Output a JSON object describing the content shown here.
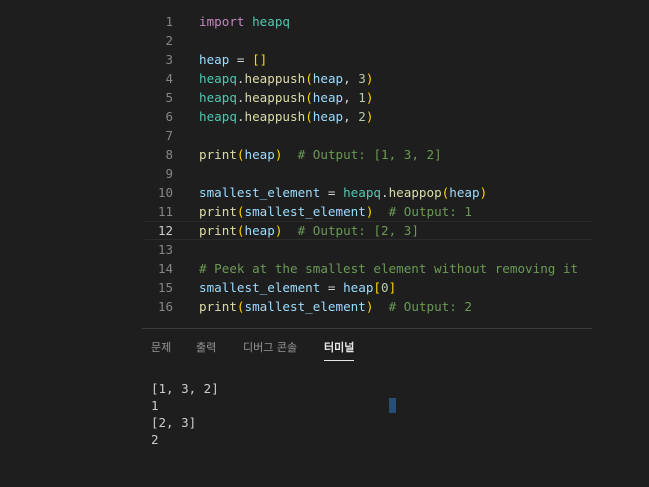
{
  "editor": {
    "lines": [
      {
        "num": "1",
        "tokens": [
          {
            "t": "import",
            "c": "kw"
          },
          {
            "t": " ",
            "c": "op"
          },
          {
            "t": "heapq",
            "c": "mod"
          }
        ]
      },
      {
        "num": "2",
        "tokens": []
      },
      {
        "num": "3",
        "tokens": [
          {
            "t": "heap",
            "c": "var"
          },
          {
            "t": " = ",
            "c": "op"
          },
          {
            "t": "[]",
            "c": "p1"
          }
        ]
      },
      {
        "num": "4",
        "tokens": [
          {
            "t": "heapq",
            "c": "mod"
          },
          {
            "t": ".",
            "c": "op"
          },
          {
            "t": "heappush",
            "c": "fn"
          },
          {
            "t": "(",
            "c": "p1"
          },
          {
            "t": "heap",
            "c": "var"
          },
          {
            "t": ", ",
            "c": "op"
          },
          {
            "t": "3",
            "c": "num"
          },
          {
            "t": ")",
            "c": "p1"
          }
        ]
      },
      {
        "num": "5",
        "tokens": [
          {
            "t": "heapq",
            "c": "mod"
          },
          {
            "t": ".",
            "c": "op"
          },
          {
            "t": "heappush",
            "c": "fn"
          },
          {
            "t": "(",
            "c": "p1"
          },
          {
            "t": "heap",
            "c": "var"
          },
          {
            "t": ", ",
            "c": "op"
          },
          {
            "t": "1",
            "c": "num"
          },
          {
            "t": ")",
            "c": "p1"
          }
        ]
      },
      {
        "num": "6",
        "tokens": [
          {
            "t": "heapq",
            "c": "mod"
          },
          {
            "t": ".",
            "c": "op"
          },
          {
            "t": "heappush",
            "c": "fn"
          },
          {
            "t": "(",
            "c": "p1"
          },
          {
            "t": "heap",
            "c": "var"
          },
          {
            "t": ", ",
            "c": "op"
          },
          {
            "t": "2",
            "c": "num"
          },
          {
            "t": ")",
            "c": "p1"
          }
        ]
      },
      {
        "num": "7",
        "tokens": []
      },
      {
        "num": "8",
        "tokens": [
          {
            "t": "print",
            "c": "fn"
          },
          {
            "t": "(",
            "c": "p1"
          },
          {
            "t": "heap",
            "c": "var"
          },
          {
            "t": ")",
            "c": "p1"
          },
          {
            "t": "  ",
            "c": "op"
          },
          {
            "t": "# Output: [1, 3, 2]",
            "c": "cm"
          }
        ]
      },
      {
        "num": "9",
        "tokens": []
      },
      {
        "num": "10",
        "tokens": [
          {
            "t": "smallest_element",
            "c": "var"
          },
          {
            "t": " = ",
            "c": "op"
          },
          {
            "t": "heapq",
            "c": "mod"
          },
          {
            "t": ".",
            "c": "op"
          },
          {
            "t": "heappop",
            "c": "fn"
          },
          {
            "t": "(",
            "c": "p1"
          },
          {
            "t": "heap",
            "c": "var"
          },
          {
            "t": ")",
            "c": "p1"
          }
        ]
      },
      {
        "num": "11",
        "tokens": [
          {
            "t": "print",
            "c": "fn"
          },
          {
            "t": "(",
            "c": "p1"
          },
          {
            "t": "smallest_element",
            "c": "var"
          },
          {
            "t": ")",
            "c": "p1"
          },
          {
            "t": "  ",
            "c": "op"
          },
          {
            "t": "# Output: 1",
            "c": "cm"
          }
        ]
      },
      {
        "num": "12",
        "tokens": [
          {
            "t": "print",
            "c": "fn"
          },
          {
            "t": "(",
            "c": "p1"
          },
          {
            "t": "heap",
            "c": "var"
          },
          {
            "t": ")",
            "c": "p1"
          },
          {
            "t": "  ",
            "c": "op"
          },
          {
            "t": "# Output: [2, 3]",
            "c": "cm"
          }
        ],
        "current": true
      },
      {
        "num": "13",
        "tokens": []
      },
      {
        "num": "14",
        "tokens": [
          {
            "t": "# Peek at the smallest element without removing it",
            "c": "cm"
          }
        ]
      },
      {
        "num": "15",
        "tokens": [
          {
            "t": "smallest_element",
            "c": "var"
          },
          {
            "t": " = ",
            "c": "op"
          },
          {
            "t": "heap",
            "c": "var"
          },
          {
            "t": "[",
            "c": "p1"
          },
          {
            "t": "0",
            "c": "num"
          },
          {
            "t": "]",
            "c": "p1"
          }
        ]
      },
      {
        "num": "16",
        "tokens": [
          {
            "t": "print",
            "c": "fn"
          },
          {
            "t": "(",
            "c": "p1"
          },
          {
            "t": "smallest_element",
            "c": "var"
          },
          {
            "t": ")",
            "c": "p1"
          },
          {
            "t": "  ",
            "c": "op"
          },
          {
            "t": "# Output: 2",
            "c": "cm"
          }
        ]
      }
    ]
  },
  "panel": {
    "tabs": [
      {
        "label": "문제",
        "active": false
      },
      {
        "label": "출력",
        "active": false
      },
      {
        "label": "디버그 콘솔",
        "active": false
      },
      {
        "label": "터미널",
        "active": true
      }
    ]
  },
  "terminal": {
    "lines": [
      "[1, 3, 2]",
      "1",
      "[2, 3]",
      "2"
    ]
  },
  "colors": {
    "background": "#1e1e1e",
    "keyword": "#c586c0",
    "module": "#4ec9b0",
    "variable": "#9cdcfe",
    "function": "#dcdcaa",
    "number": "#b5cea8",
    "comment": "#6a9955",
    "bracket": "#ffd700",
    "terminal_cursor": "#264f78"
  }
}
